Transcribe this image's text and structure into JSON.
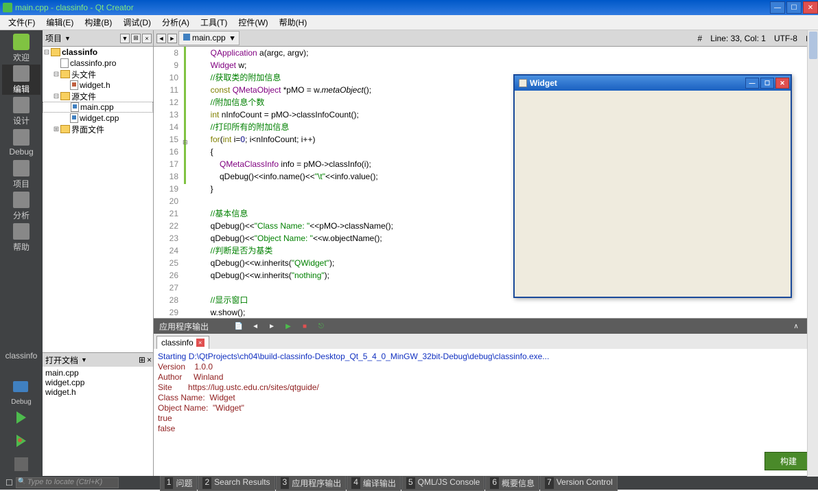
{
  "title": "main.cpp - classinfo - Qt Creator",
  "menu": [
    "文件(F)",
    "编辑(E)",
    "构建(B)",
    "调试(D)",
    "分析(A)",
    "工具(T)",
    "控件(W)",
    "帮助(H)"
  ],
  "sidebar": [
    {
      "label": "欢迎",
      "icon": "qt"
    },
    {
      "label": "编辑",
      "active": true
    },
    {
      "label": "设计"
    },
    {
      "label": "Debug"
    },
    {
      "label": "项目"
    },
    {
      "label": "分析"
    },
    {
      "label": "帮助"
    }
  ],
  "run_config": "classinfo",
  "run_config_sub": "Debug",
  "project_label": "项目",
  "breadcrumb": "main.cpp",
  "status": {
    "line_col": "Line: 33, Col: 1",
    "encoding": "UTF-8"
  },
  "tree": {
    "root": "classinfo",
    "pro": "classinfo.pro",
    "headers": "头文件",
    "header_files": [
      "widget.h"
    ],
    "sources": "源文件",
    "source_files": [
      "main.cpp",
      "widget.cpp"
    ],
    "forms": "界面文件"
  },
  "code_start_line": 8,
  "code": [
    {
      "t": [
        [
          "type",
          "QApplication"
        ],
        [
          "",
          " a(argc, argv);"
        ]
      ]
    },
    {
      "t": [
        [
          "type",
          "Widget"
        ],
        [
          "",
          " w;"
        ]
      ]
    },
    {
      "t": [
        [
          "cmt",
          "//获取类的附加信息"
        ]
      ]
    },
    {
      "t": [
        [
          "kw",
          "const"
        ],
        [
          "",
          " "
        ],
        [
          "type",
          "QMetaObject"
        ],
        [
          "",
          " *pMO = w."
        ],
        [
          "func",
          "metaObject"
        ],
        [
          "",
          "();"
        ]
      ]
    },
    {
      "t": [
        [
          "cmt",
          "//附加信息个数"
        ]
      ]
    },
    {
      "t": [
        [
          "kw",
          "int"
        ],
        [
          "",
          " nInfoCount = pMO->classInfoCount();"
        ]
      ]
    },
    {
      "t": [
        [
          "cmt",
          "//打印所有的附加信息"
        ]
      ]
    },
    {
      "t": [
        [
          "kw",
          "for"
        ],
        [
          "",
          "("
        ],
        [
          "kw",
          "int"
        ],
        [
          "",
          " i="
        ],
        [
          "num",
          "0"
        ],
        [
          "",
          "; i<nInfoCount; i++)"
        ]
      ]
    },
    {
      "t": [
        [
          "",
          "{"
        ]
      ]
    },
    {
      "t": [
        [
          "",
          "    "
        ],
        [
          "type",
          "QMetaClassInfo"
        ],
        [
          "",
          " info = pMO->classInfo(i);"
        ]
      ]
    },
    {
      "t": [
        [
          "",
          "    qDebug()<<info.name()<<"
        ],
        [
          "str",
          "\"\\t\""
        ],
        [
          "",
          "<<info.value();"
        ]
      ]
    },
    {
      "t": [
        [
          "",
          "}"
        ]
      ]
    },
    {
      "t": [
        [
          "",
          ""
        ]
      ]
    },
    {
      "t": [
        [
          "cmt",
          "//基本信息"
        ]
      ]
    },
    {
      "t": [
        [
          "",
          "qDebug()<<"
        ],
        [
          "str",
          "\"Class Name: \""
        ],
        [
          "",
          "<<pMO->className();"
        ]
      ]
    },
    {
      "t": [
        [
          "",
          "qDebug()<<"
        ],
        [
          "str",
          "\"Object Name: \""
        ],
        [
          "",
          "<<w.objectName();"
        ]
      ]
    },
    {
      "t": [
        [
          "cmt",
          "//判断是否为基类"
        ]
      ]
    },
    {
      "t": [
        [
          "",
          "qDebug()<<w.inherits("
        ],
        [
          "str",
          "\"QWidget\""
        ],
        [
          "",
          ");"
        ]
      ]
    },
    {
      "t": [
        [
          "",
          "qDebug()<<w.inherits("
        ],
        [
          "str",
          "\"nothing\""
        ],
        [
          "",
          ");"
        ]
      ]
    },
    {
      "t": [
        [
          "",
          ""
        ]
      ]
    },
    {
      "t": [
        [
          "cmt",
          "//显示窗口"
        ]
      ]
    },
    {
      "t": [
        [
          "",
          "w.show();"
        ]
      ]
    },
    {
      "t": [
        [
          "",
          ""
        ]
      ]
    }
  ],
  "open_docs_label": "打开文档",
  "open_docs": [
    "main.cpp",
    "widget.cpp",
    "widget.h"
  ],
  "output_title": "应用程序输出",
  "output_tab": "classinfo",
  "output_lines": [
    {
      "cls": "blue",
      "text": "Starting D:\\QtProjects\\ch04\\build-classinfo-Desktop_Qt_5_4_0_MinGW_32bit-Debug\\debug\\classinfo.exe..."
    },
    {
      "cls": "darkred",
      "text": "Version    1.0.0"
    },
    {
      "cls": "darkred",
      "text": "Author     Winland"
    },
    {
      "cls": "darkred",
      "text": "Site       https://lug.ustc.edu.cn/sites/qtguide/"
    },
    {
      "cls": "darkred",
      "text": "Class Name:  Widget"
    },
    {
      "cls": "darkred",
      "text": "Object Name:  \"Widget\""
    },
    {
      "cls": "darkred",
      "text": "true"
    },
    {
      "cls": "darkred",
      "text": "false"
    }
  ],
  "build_badge": "构建",
  "search_placeholder": "Type to locate (Ctrl+K)",
  "bottom_tabs": [
    {
      "n": "1",
      "label": "问题"
    },
    {
      "n": "2",
      "label": "Search Results"
    },
    {
      "n": "3",
      "label": "应用程序输出"
    },
    {
      "n": "4",
      "label": "编译输出"
    },
    {
      "n": "5",
      "label": "QML/JS Console"
    },
    {
      "n": "6",
      "label": "概要信息"
    },
    {
      "n": "7",
      "label": "Version Control"
    }
  ],
  "widget_window_title": "Widget"
}
